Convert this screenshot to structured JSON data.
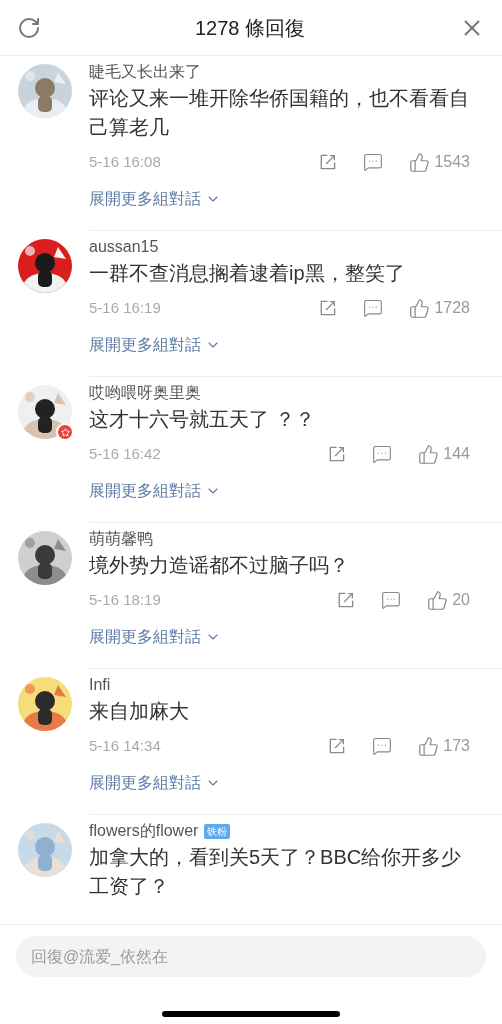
{
  "header": {
    "title": "1278 條回復"
  },
  "comments": [
    {
      "name": "睫毛又长出来了",
      "text": "评论又来一堆开除华侨国籍的，也不看看自己算老几",
      "time": "5-16 16:08",
      "likes": "1543",
      "expand": "展開更多組對話",
      "avatar_badge": false
    },
    {
      "name": "aussan15",
      "text": "一群不查消息搁着逮着ip黑，整笑了",
      "time": "5-16 16:19",
      "likes": "1728",
      "expand": "展開更多組對話",
      "avatar_badge": false
    },
    {
      "name": "哎哟喂呀奥里奥",
      "text": "这才十六号就五天了 ？？",
      "time": "5-16 16:42",
      "likes": "144",
      "expand": "展開更多組對話",
      "avatar_badge": true
    },
    {
      "name": "萌萌馨鸭",
      "text": "境外势力造谣都不过脑子吗？",
      "time": "5-16 18:19",
      "likes": "20",
      "expand": "展開更多組對話",
      "avatar_badge": false
    },
    {
      "name": "Infi",
      "text": "来自加麻大",
      "time": "5-16 14:34",
      "likes": "173",
      "expand": "展開更多組對話",
      "avatar_badge": false
    },
    {
      "name": "flowers的flower",
      "tag": "铁粉",
      "text": "加拿大的，看到关5天了？BBC给你开多少工资了？",
      "avatar_badge": false
    }
  ],
  "reply_field": {
    "placeholder": "回復@流爱_依然在"
  }
}
